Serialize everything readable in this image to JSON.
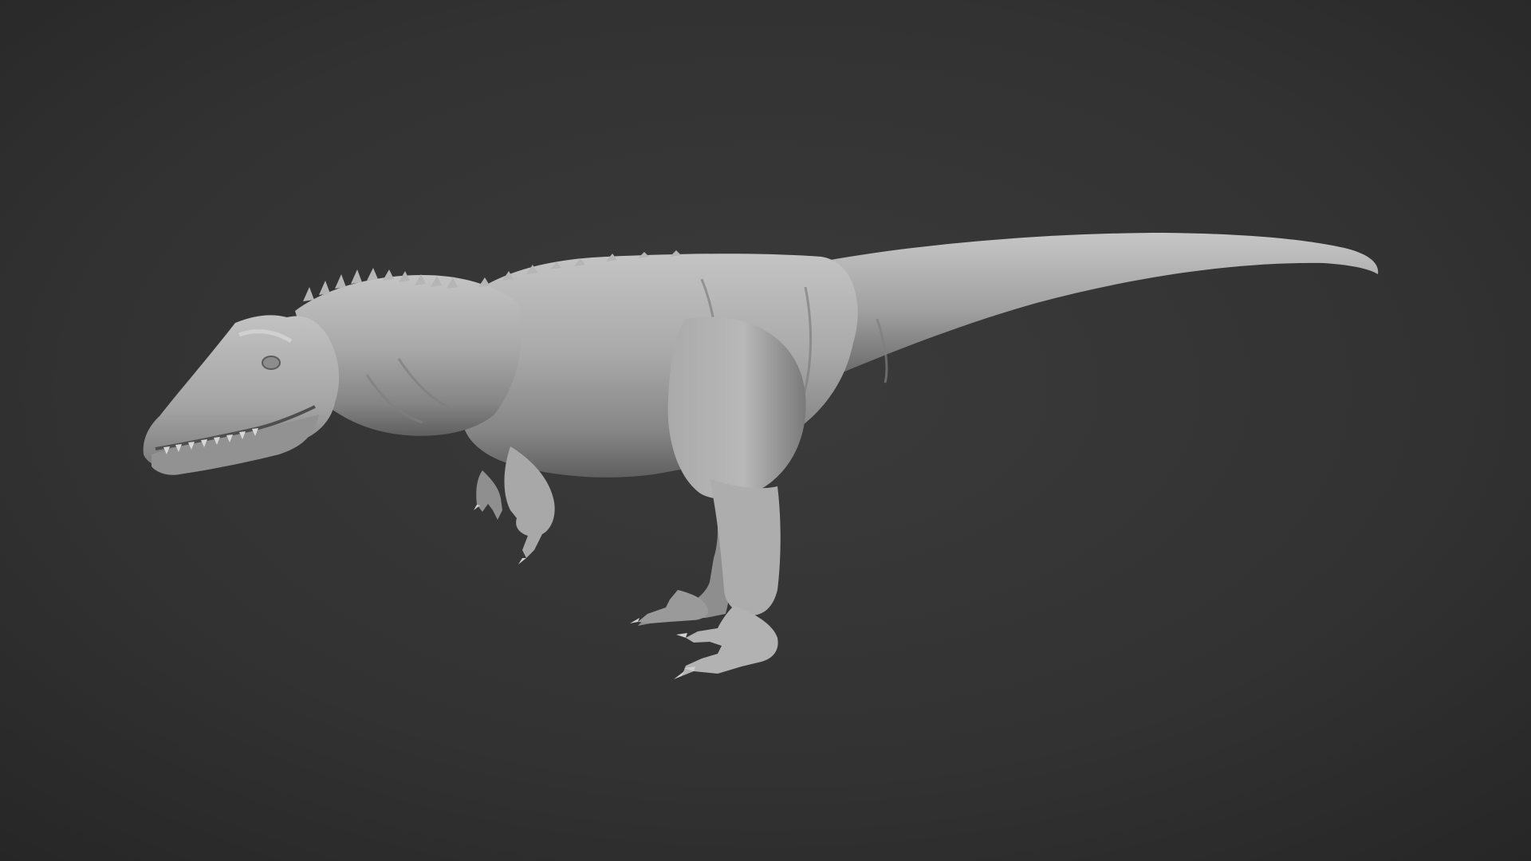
{
  "scene": {
    "subject_icon": "dinosaur-sculpt-icon",
    "colors": {
      "background_center": "#3a3a3a",
      "background_edge": "#252525",
      "model_light": "#bdbdbd",
      "model_mid": "#9c9c9c",
      "model_dark": "#6e6e6e",
      "model_shadow": "#4a4a4a"
    }
  }
}
